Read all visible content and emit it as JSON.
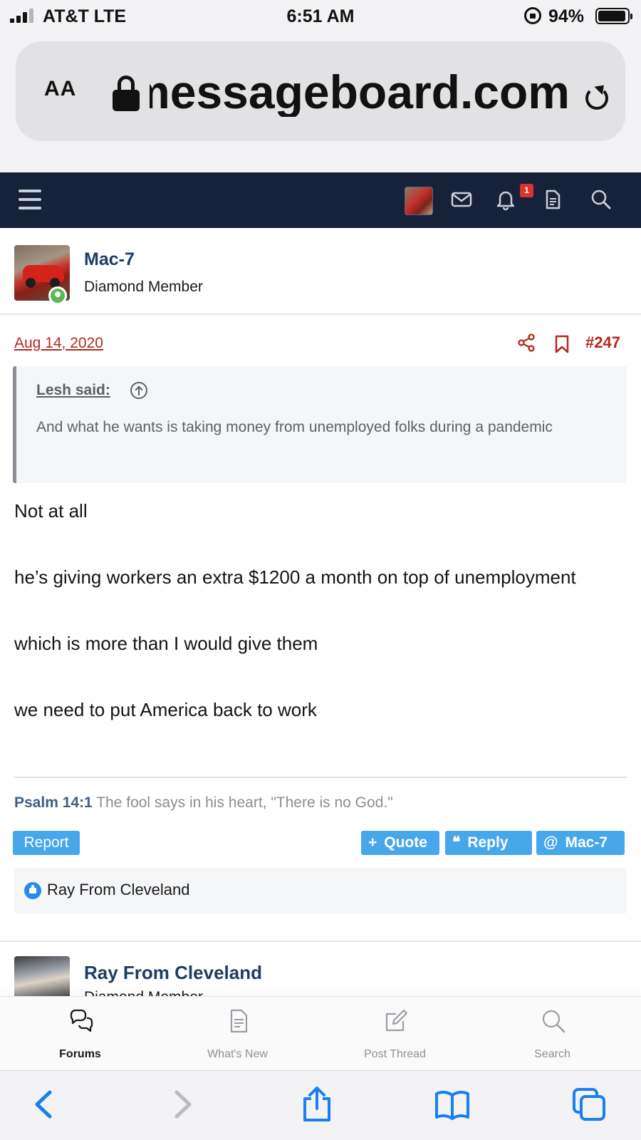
{
  "status_bar": {
    "carrier": "AT&T  LTE",
    "time": "6:51 AM",
    "battery": "94%",
    "battery_level": 0.94
  },
  "browser": {
    "text_size_label": "AA",
    "url": "messageboard.com"
  },
  "forum_nav": {
    "notification_count": "1"
  },
  "post": {
    "username": "Mac-7",
    "user_title": "Diamond Member",
    "date": "Aug 14, 2020",
    "post_number": "#247",
    "quote": {
      "author": "Lesh said:",
      "text": "And what he wants is taking money from unemployed folks during a pandemic"
    },
    "body": [
      "Not at all",
      "he’s giving workers an extra $1200 a month on top of unemployment",
      "which is more than I would give them",
      "we need to put America back to work"
    ],
    "signature": {
      "reference": "Psalm 14:1",
      "text": "The fool says in his heart, \"There is no God.\""
    },
    "actions": {
      "report": "Report",
      "quote": "Quote",
      "reply": "Reply",
      "mention": "Mac-7"
    },
    "reactions": {
      "user": "Ray From Cleveland"
    }
  },
  "next_post": {
    "username": "Ray From Cleveland",
    "user_title": "Diamond Member"
  },
  "forum_tabs": [
    {
      "label": "Forums",
      "icon": "forums-icon",
      "active": true
    },
    {
      "label": "What's New",
      "icon": "document-icon",
      "active": false
    },
    {
      "label": "Post Thread",
      "icon": "compose-icon",
      "active": false
    },
    {
      "label": "Search",
      "icon": "search-icon",
      "active": false
    }
  ],
  "colors": {
    "nav_background": "#16223a",
    "accent_red": "#b5281f",
    "button_blue": "#47a7eb",
    "username_blue": "#1f3c66",
    "safari_blue": "#1a7ff0"
  }
}
